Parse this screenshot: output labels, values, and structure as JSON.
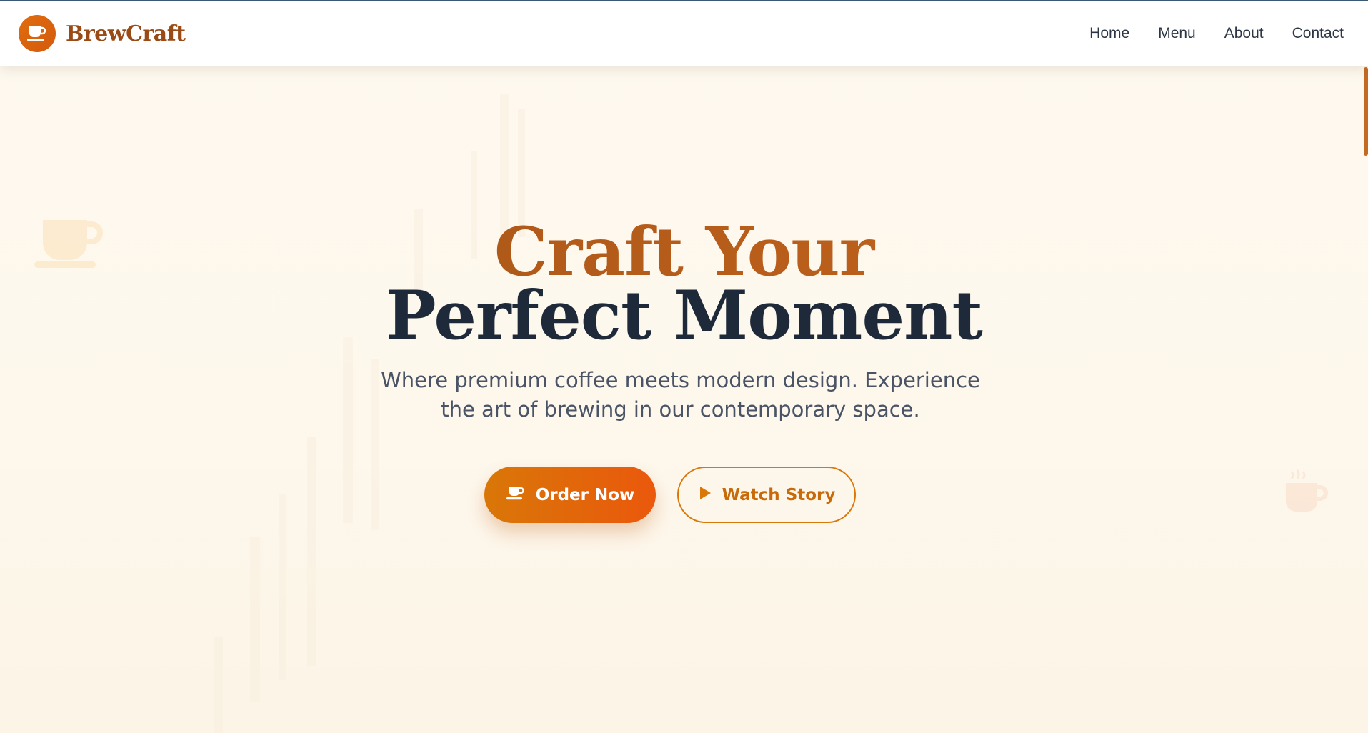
{
  "brand": {
    "name": "BrewCraft",
    "logo_icon": "coffee-cup-icon",
    "color": "#9a4a14"
  },
  "nav": {
    "items": [
      {
        "label": "Home"
      },
      {
        "label": "Menu"
      },
      {
        "label": "About"
      },
      {
        "label": "Contact"
      }
    ]
  },
  "hero": {
    "title_line_1": "Craft Your",
    "title_line_2": "Perfect Moment",
    "subtitle": "Where premium coffee meets modern design. Experience the art of brewing in our contemporary space.",
    "primary_button": {
      "label": "Order Now",
      "icon": "coffee-cup-icon"
    },
    "secondary_button": {
      "label": "Watch Story",
      "icon": "play-icon"
    }
  },
  "colors": {
    "accent": "#ea580c",
    "accent_start": "#d97708",
    "title_brown": "#b05a18",
    "title_dark": "#1e2939",
    "background": "#fdf8ee"
  }
}
